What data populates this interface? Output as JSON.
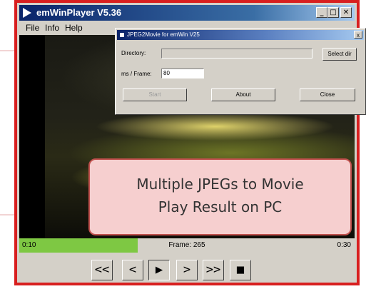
{
  "window": {
    "title": "emWinPlayer V5.36",
    "min_glyph": "_",
    "max_glyph": "□",
    "close_glyph": "✕"
  },
  "menu": [
    "File",
    "Info",
    "Help"
  ],
  "dialog": {
    "title": "JPEG2Movie for emWin V25",
    "close_glyph": "x",
    "directory_label": "Directory:",
    "directory_value": "",
    "select_button": "Select dir",
    "ms_label": "ms / Frame:",
    "ms_value": "80",
    "start_button": "Start",
    "about_button": "About",
    "close_button": "Close"
  },
  "overlay": {
    "line1": "Multiple JPEGs to Movie",
    "line2": "Play Result on PC"
  },
  "progress": {
    "elapsed": "0:10",
    "frame_label": "Frame: 265",
    "total": "0:30",
    "fraction": 0.353
  },
  "controls": {
    "rewind": "<<",
    "prev": "<",
    "play": "▶",
    "next": ">",
    "forward": ">>",
    "stop": "■"
  },
  "colors": {
    "frame_border": "#d81f1f",
    "progress_fill": "#7ec843",
    "callout_bg": "#f6cfcf",
    "callout_border": "#c0504d"
  }
}
